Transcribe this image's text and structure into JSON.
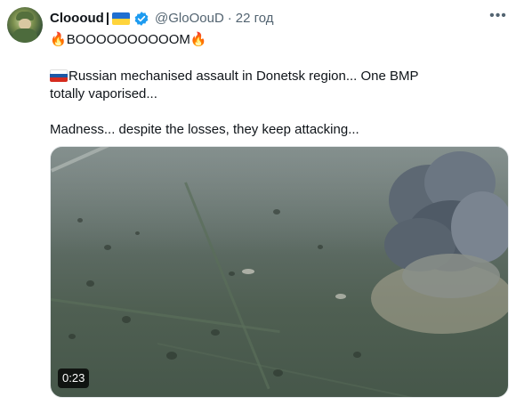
{
  "tweet": {
    "author": {
      "display_name": "Cloooud",
      "separator": "|",
      "handle": "@GloOouD",
      "time": "22 год",
      "verified": true
    },
    "text": {
      "line1": "BOOOOOOOOOOM",
      "line2": "Russian mechanised assault in Donetsk region... One BMP totally vaporised...",
      "line3": "Madness... despite the losses, they keep attacking..."
    },
    "emoji": {
      "fire": "🔥"
    },
    "media": {
      "type": "video",
      "duration": "0:23"
    }
  },
  "icons": {
    "more": "more-horizontal-icon",
    "verified": "verified-badge-icon",
    "flag_ukraine": "ukraine-flag-icon",
    "flag_russia": "russia-flag-icon",
    "fire": "fire-emoji-icon"
  },
  "colors": {
    "text_primary": "#0f1419",
    "text_secondary": "#536471",
    "verified_blue": "#1d9bf0",
    "flag_blue": "#1f6fd1",
    "flag_yellow": "#ffd43b"
  }
}
